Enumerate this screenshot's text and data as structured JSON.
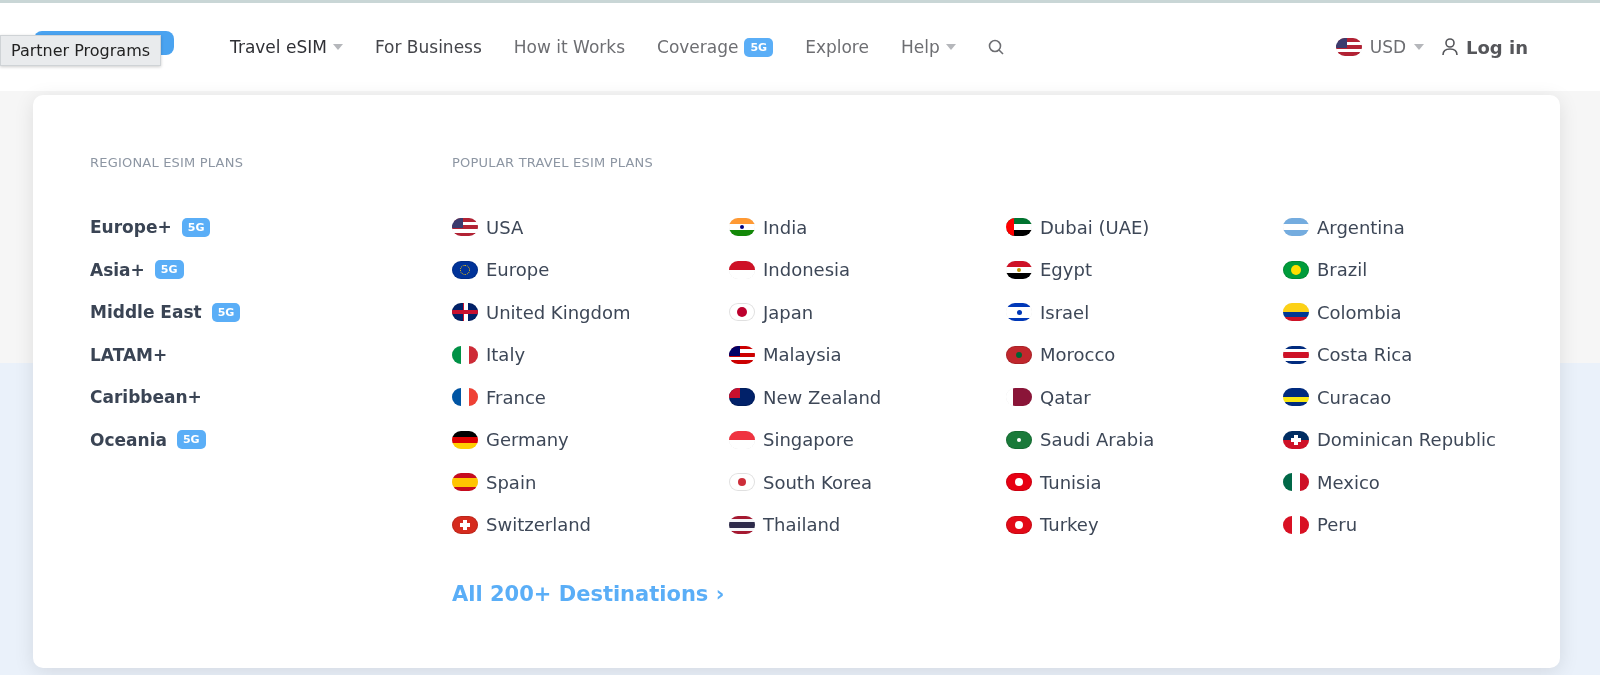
{
  "tooltip": "Partner Programs",
  "nav": [
    {
      "label": "Travel eSIM",
      "dropdown": true,
      "selected": true,
      "emphasized": false
    },
    {
      "label": "For Business",
      "dropdown": false,
      "selected": false,
      "emphasized": true
    },
    {
      "label": "How it Works",
      "dropdown": false,
      "selected": false,
      "emphasized": false
    },
    {
      "label": "Coverage",
      "dropdown": false,
      "selected": false,
      "emphasized": false,
      "badge": "5G"
    },
    {
      "label": "Explore",
      "dropdown": false,
      "selected": false,
      "emphasized": false
    },
    {
      "label": "Help",
      "dropdown": true,
      "selected": false,
      "emphasized": false
    }
  ],
  "currency": "USD",
  "login": "Log in",
  "regional": {
    "heading": "REGIONAL ESIM PLANS",
    "items": [
      {
        "name": "Europe+",
        "badge": "5G"
      },
      {
        "name": "Asia+",
        "badge": "5G"
      },
      {
        "name": "Middle East",
        "badge": "5G"
      },
      {
        "name": "LATAM+"
      },
      {
        "name": "Caribbean+"
      },
      {
        "name": "Oceania",
        "badge": "5G"
      }
    ]
  },
  "popular": {
    "heading": "POPULAR TRAVEL ESIM PLANS",
    "countries": [
      "USA",
      "Europe",
      "United Kingdom",
      "Italy",
      "France",
      "Germany",
      "Spain",
      "Switzerland",
      "India",
      "Indonesia",
      "Japan",
      "Malaysia",
      "New Zealand",
      "Singapore",
      "South Korea",
      "Thailand",
      "Dubai (UAE)",
      "Egypt",
      "Israel",
      "Morocco",
      "Qatar",
      "Saudi Arabia",
      "Tunisia",
      "Turkey",
      "Argentina",
      "Brazil",
      "Colombia",
      "Costa Rica",
      "Curacao",
      "Dominican Republic",
      "Mexico",
      "Peru"
    ]
  },
  "all_link": "All 200+ Destinations ›"
}
